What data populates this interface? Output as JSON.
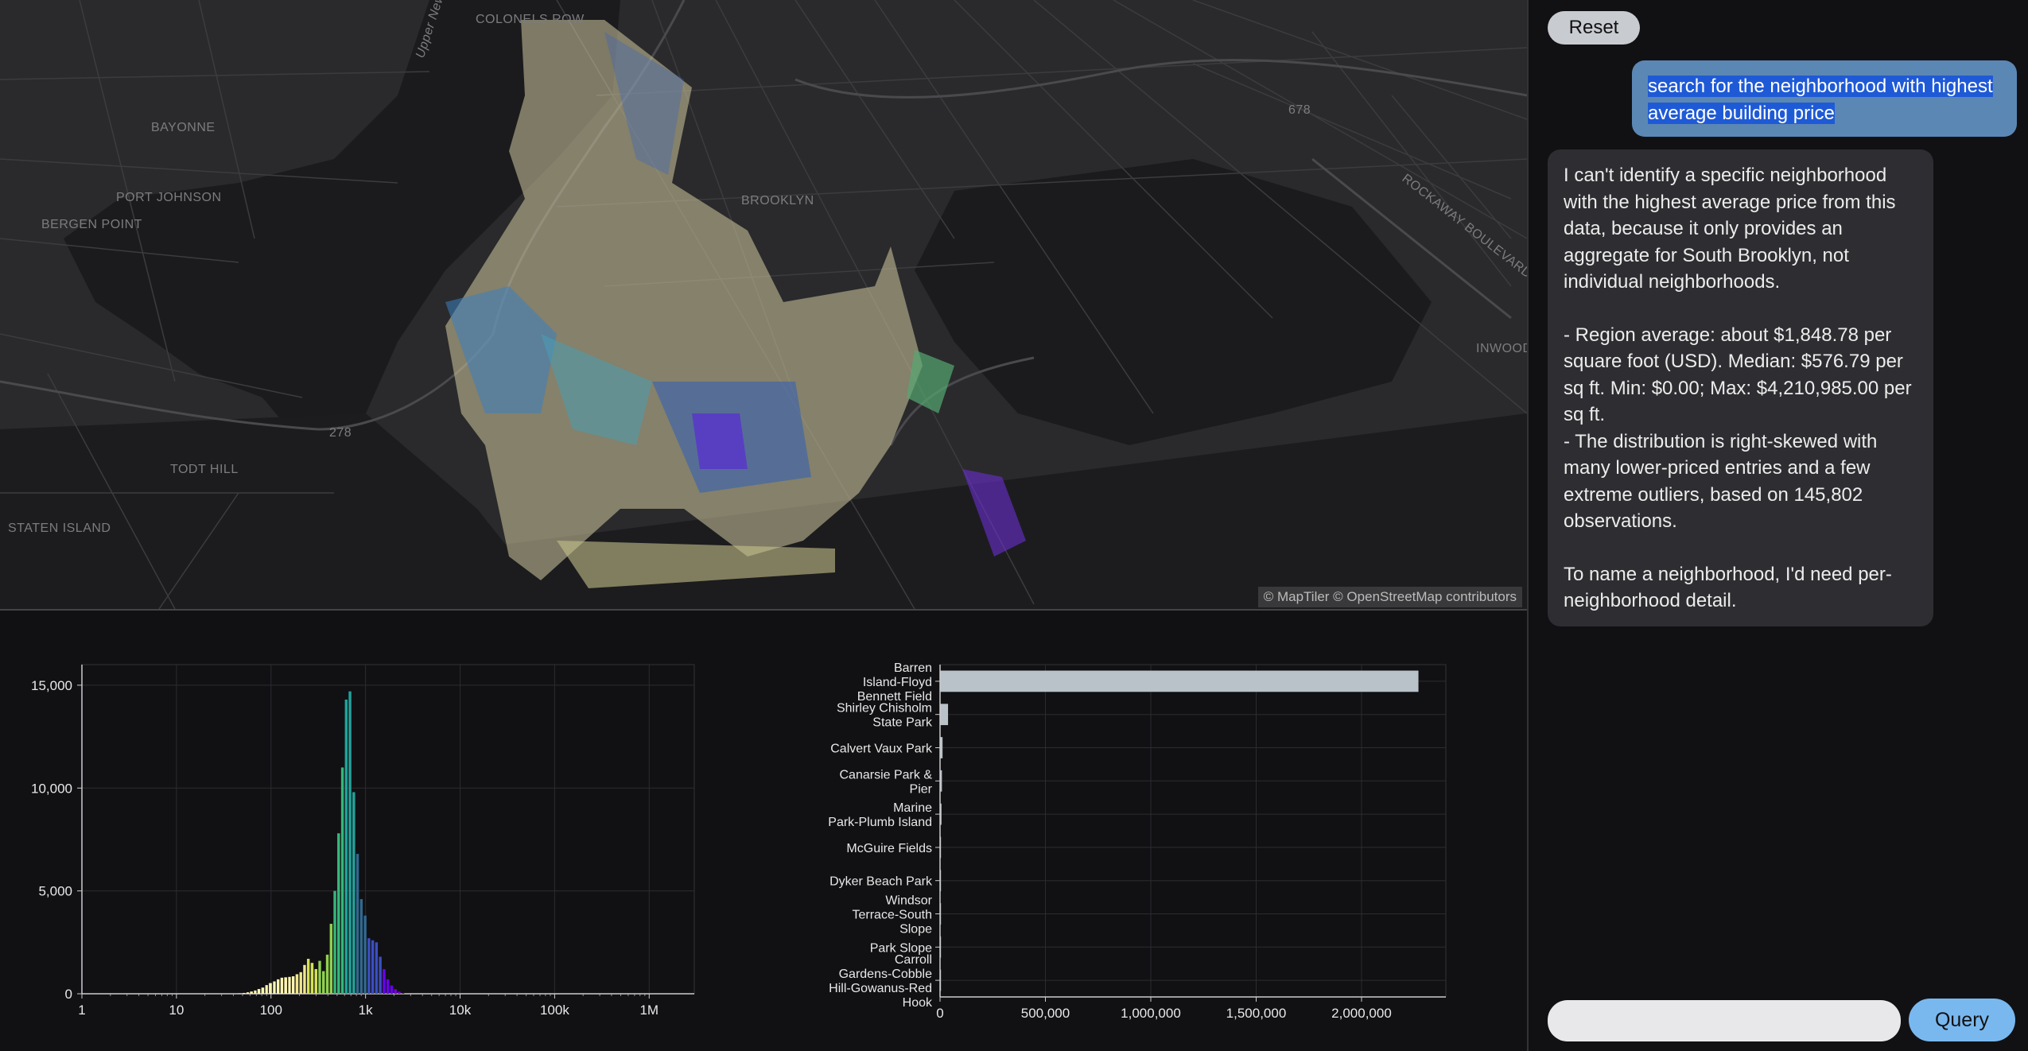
{
  "map": {
    "attribution": "© MapTiler © OpenStreetMap contributors",
    "labels": [
      "COLONELS ROW",
      "Upper New York Bay",
      "BAYONNE",
      "PORT JOHNSON",
      "BERGEN POINT",
      "BROOKLYN",
      "TODT HILL",
      "STATEN ISLAND",
      "INWOOD",
      "ROCKAWAY BOULEVARD",
      "678",
      "278"
    ],
    "colors": {
      "background": "#2a2a2c",
      "water": "#1b1b1d",
      "road": "#3f3f42"
    }
  },
  "chat": {
    "reset_label": "Reset",
    "user_message_line1": "search for the neighborhood with highest",
    "user_message_line2": "average building price",
    "assistant_paragraphs": [
      "I can't identify a specific neighborhood with the highest average price from this data, because it only provides an aggregate for South Brooklyn, not individual neighborhoods.",
      "- Region average: about $1,848.78 per square foot (USD). Median: $576.79 per sq ft. Min: $0.00; Max: $4,210,985.00 per sq ft.",
      "- The distribution is right-skewed with many lower-priced entries and a few extreme outliers, based on 145,802 observations.",
      "To name a neighborhood, I'd need per-neighborhood detail."
    ],
    "query_placeholder": "",
    "query_label": "Query",
    "colors": {
      "user_bubble": "#5b87b5",
      "assistant_bubble": "#2e2e32",
      "query_button": "#79b8ef"
    }
  },
  "chart_data": [
    {
      "type": "bar",
      "subtype": "histogram",
      "xscale": "log",
      "xlim": [
        1,
        3000000
      ],
      "ylim": [
        0,
        16000
      ],
      "xticks": [
        "1",
        "10",
        "100",
        "1k",
        "10k",
        "100k",
        "1M"
      ],
      "yticks": [
        "0",
        "5,000",
        "10,000",
        "15,000"
      ],
      "grid": true,
      "colormap": "viridis-reversed",
      "bins": [
        {
          "x": 45,
          "y": 20
        },
        {
          "x": 50,
          "y": 40
        },
        {
          "x": 55,
          "y": 70
        },
        {
          "x": 60,
          "y": 110
        },
        {
          "x": 66,
          "y": 160
        },
        {
          "x": 72,
          "y": 230
        },
        {
          "x": 79,
          "y": 300
        },
        {
          "x": 87,
          "y": 420
        },
        {
          "x": 95,
          "y": 520
        },
        {
          "x": 105,
          "y": 600
        },
        {
          "x": 115,
          "y": 700
        },
        {
          "x": 126,
          "y": 780
        },
        {
          "x": 138,
          "y": 800
        },
        {
          "x": 152,
          "y": 820
        },
        {
          "x": 166,
          "y": 850
        },
        {
          "x": 182,
          "y": 950
        },
        {
          "x": 200,
          "y": 1050
        },
        {
          "x": 219,
          "y": 1400
        },
        {
          "x": 240,
          "y": 1700
        },
        {
          "x": 263,
          "y": 1500
        },
        {
          "x": 289,
          "y": 1200
        },
        {
          "x": 317,
          "y": 1600
        },
        {
          "x": 347,
          "y": 1100
        },
        {
          "x": 381,
          "y": 1900
        },
        {
          "x": 418,
          "y": 3400
        },
        {
          "x": 458,
          "y": 5000
        },
        {
          "x": 502,
          "y": 7800
        },
        {
          "x": 551,
          "y": 11000
        },
        {
          "x": 604,
          "y": 14300
        },
        {
          "x": 662,
          "y": 14700
        },
        {
          "x": 726,
          "y": 9800
        },
        {
          "x": 796,
          "y": 6800
        },
        {
          "x": 873,
          "y": 4600
        },
        {
          "x": 957,
          "y": 3800
        },
        {
          "x": 1050,
          "y": 2700
        },
        {
          "x": 1151,
          "y": 2600
        },
        {
          "x": 1262,
          "y": 2500
        },
        {
          "x": 1384,
          "y": 1800
        },
        {
          "x": 1518,
          "y": 1200
        },
        {
          "x": 1665,
          "y": 700
        },
        {
          "x": 1826,
          "y": 400
        },
        {
          "x": 2002,
          "y": 220
        },
        {
          "x": 2196,
          "y": 100
        },
        {
          "x": 2408,
          "y": 40
        }
      ]
    },
    {
      "type": "bar",
      "orientation": "horizontal",
      "xlim": [
        0,
        2400000
      ],
      "xticks": [
        "0",
        "500,000",
        "1,000,000",
        "1,500,000",
        "2,000,000"
      ],
      "grid": true,
      "bar_color": "#b9c2c8",
      "categories": [
        [
          "Barren",
          "Island-Floyd",
          "Bennett Field"
        ],
        [
          "Shirley Chisholm",
          "State Park"
        ],
        [
          "Calvert Vaux Park"
        ],
        [
          "Canarsie Park &",
          "Pier"
        ],
        [
          "Marine",
          "Park-Plumb Island"
        ],
        [
          "McGuire Fields"
        ],
        [
          "Dyker Beach Park"
        ],
        [
          "Windsor",
          "Terrace-South",
          "Slope"
        ],
        [
          "Park Slope"
        ],
        [
          "Carroll",
          "Gardens-Cobble",
          "Hill-Gowanus-Red",
          "Hook"
        ]
      ],
      "values": [
        2270000,
        38000,
        12000,
        9000,
        7000,
        4000,
        3000,
        2500,
        2000,
        1800
      ]
    }
  ]
}
